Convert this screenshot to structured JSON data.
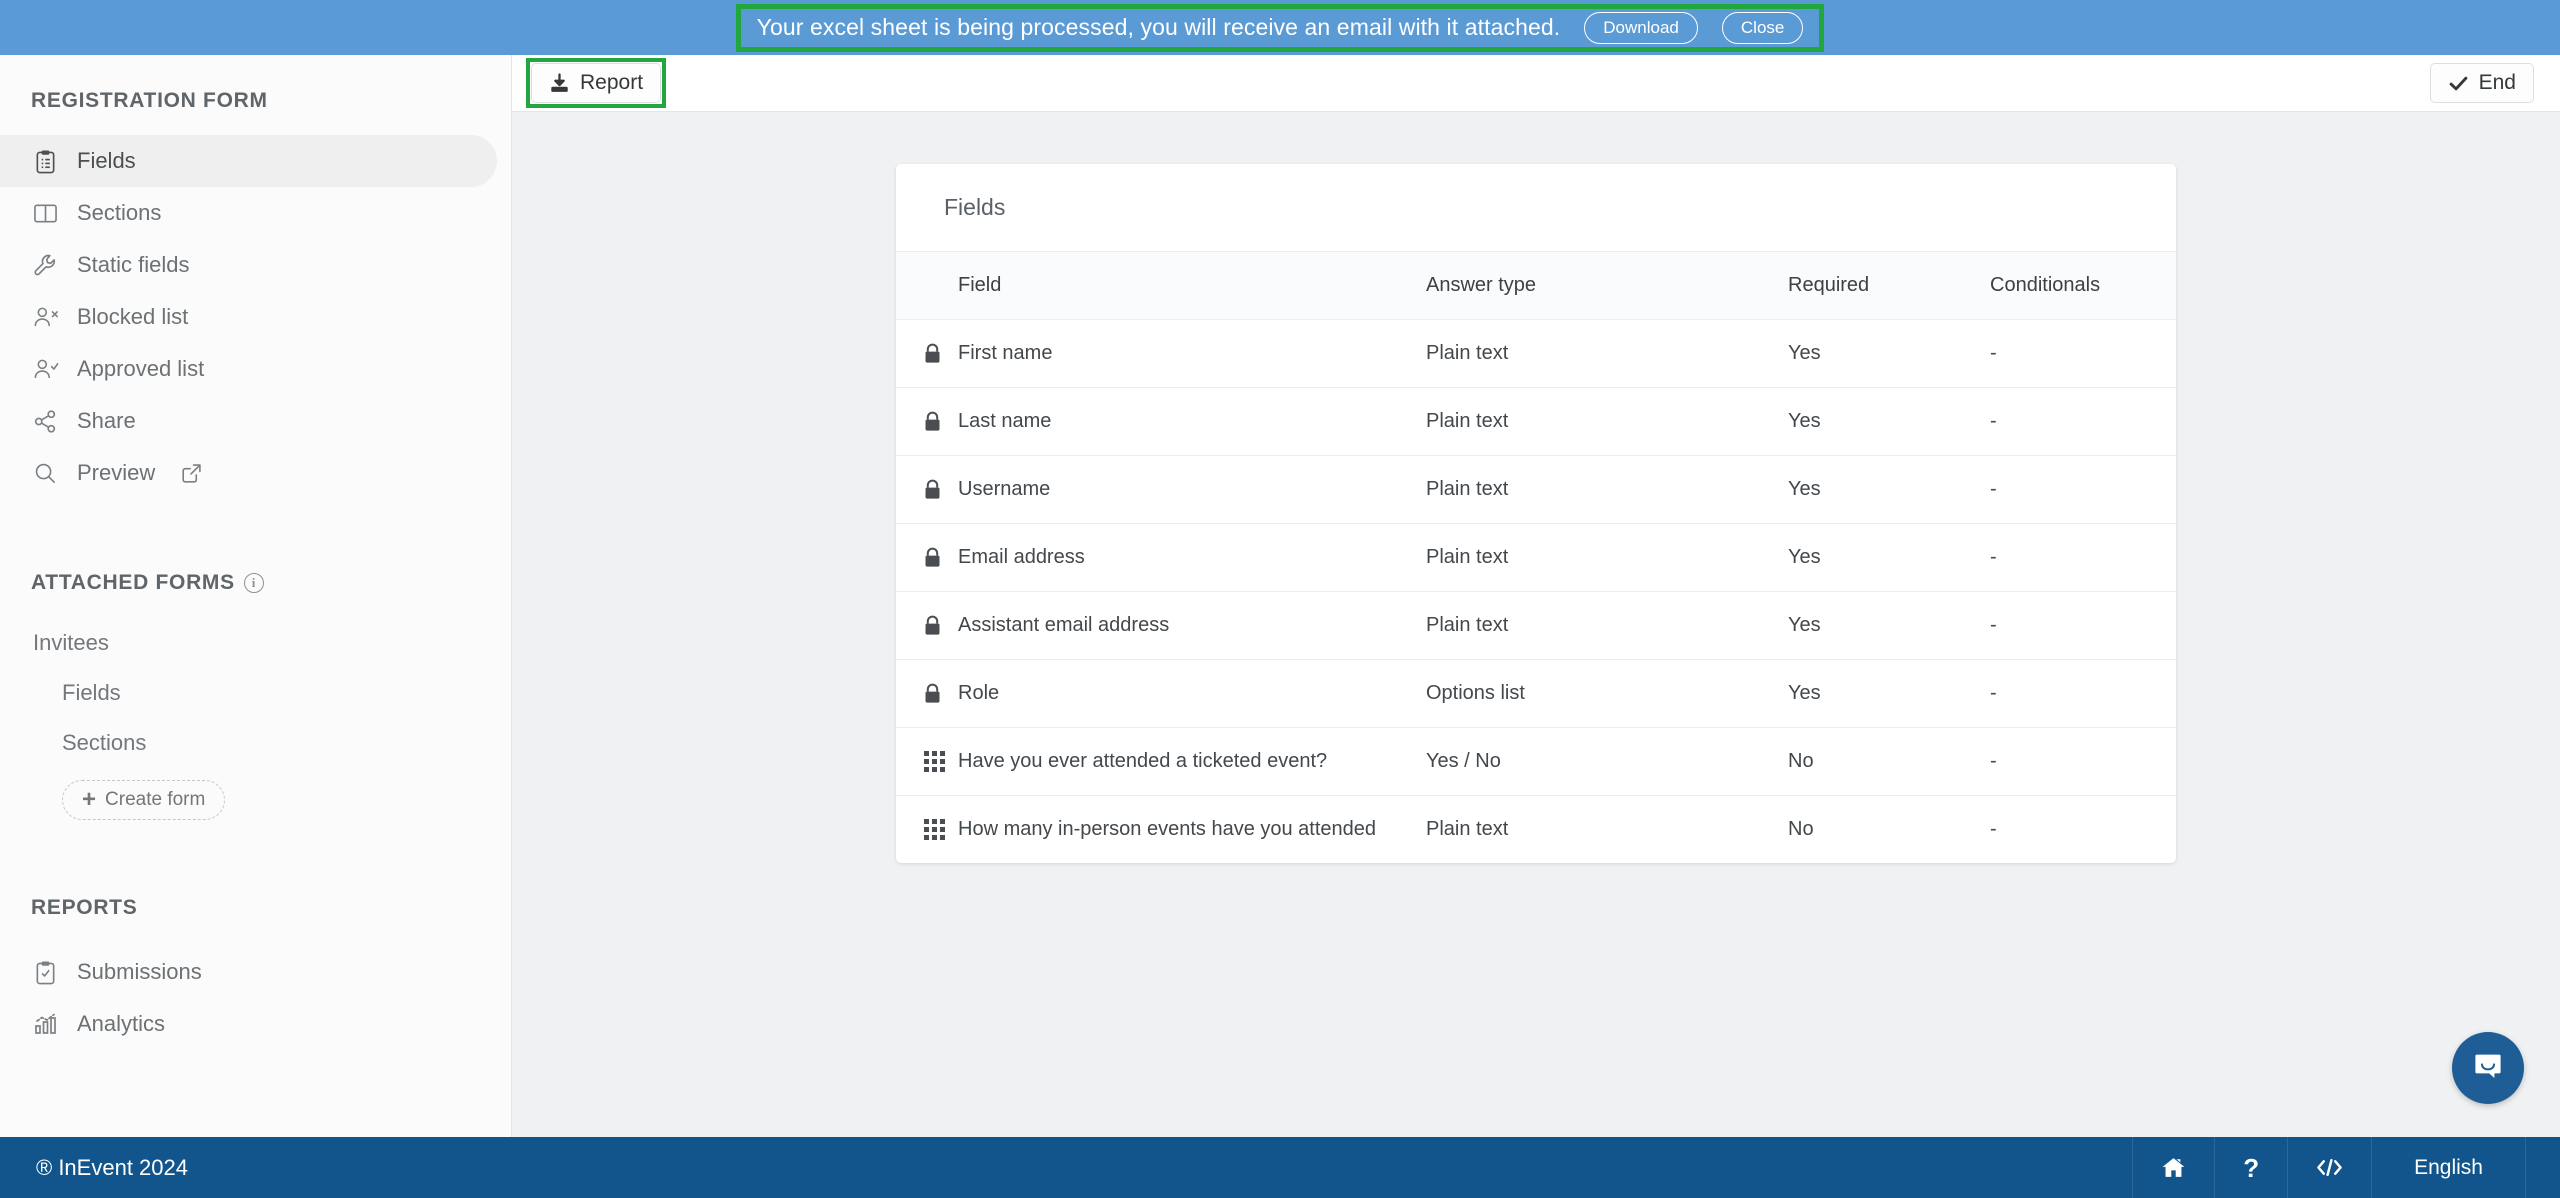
{
  "banner": {
    "message": "Your excel sheet is being processed, you will receive an email with it attached.",
    "download_label": "Download",
    "close_label": "Close",
    "background_color": "#5b9bd5",
    "highlight_color": "#22a73f"
  },
  "toolbar": {
    "report_label": "Report",
    "report_icon": "download-icon",
    "end_label": "End",
    "end_icon": "check-icon"
  },
  "sidebar": {
    "section_registration": "REGISTRATION FORM",
    "items": [
      {
        "label": "Fields",
        "icon": "clipboard-icon",
        "active": true
      },
      {
        "label": "Sections",
        "icon": "columns-icon",
        "active": false
      },
      {
        "label": "Static fields",
        "icon": "wrench-icon",
        "active": false
      },
      {
        "label": "Blocked list",
        "icon": "user-x-icon",
        "active": false
      },
      {
        "label": "Approved list",
        "icon": "user-check-icon",
        "active": false
      },
      {
        "label": "Share",
        "icon": "share-icon",
        "active": false
      },
      {
        "label": "Preview",
        "icon": "search-icon",
        "active": false,
        "external": true
      }
    ],
    "section_attached": "ATTACHED FORMS",
    "attached_info_icon": "info-icon",
    "attached": {
      "group_label": "Invitees",
      "children": [
        "Fields",
        "Sections"
      ],
      "create_label": "Create form"
    },
    "section_reports": "REPORTS",
    "reports": [
      {
        "label": "Submissions",
        "icon": "clipboard-check-icon"
      },
      {
        "label": "Analytics",
        "icon": "bar-chart-icon"
      }
    ]
  },
  "main": {
    "card_title": "Fields",
    "table": {
      "columns": [
        "Field",
        "Answer type",
        "Required",
        "Conditionals"
      ],
      "rows": [
        {
          "icon": "lock-icon",
          "field": "First name",
          "type": "Plain text",
          "required": "Yes",
          "conditionals": "-"
        },
        {
          "icon": "lock-icon",
          "field": "Last name",
          "type": "Plain text",
          "required": "Yes",
          "conditionals": "-"
        },
        {
          "icon": "lock-icon",
          "field": "Username",
          "type": "Plain text",
          "required": "Yes",
          "conditionals": "-"
        },
        {
          "icon": "lock-icon",
          "field": "Email address",
          "type": "Plain text",
          "required": "Yes",
          "conditionals": "-"
        },
        {
          "icon": "lock-icon",
          "field": "Assistant email address",
          "type": "Plain text",
          "required": "Yes",
          "conditionals": "-"
        },
        {
          "icon": "lock-icon",
          "field": "Role",
          "type": "Options list",
          "required": "Yes",
          "conditionals": "-"
        },
        {
          "icon": "grid-icon",
          "field": "Have you ever attended a ticketed event?",
          "type": "Yes / No",
          "required": "No",
          "conditionals": "-"
        },
        {
          "icon": "grid-icon",
          "field": "How many in-person events have you attended",
          "type": "Plain text",
          "required": "No",
          "conditionals": "-"
        }
      ]
    }
  },
  "footer": {
    "copyright": "® InEvent 2024",
    "home_icon": "home-icon",
    "help_icon": "question-icon",
    "code_icon": "code-icon",
    "language": "English",
    "background_color": "#11558c"
  },
  "chat": {
    "icon": "chat-bubble-icon",
    "color": "#1e5d96"
  }
}
